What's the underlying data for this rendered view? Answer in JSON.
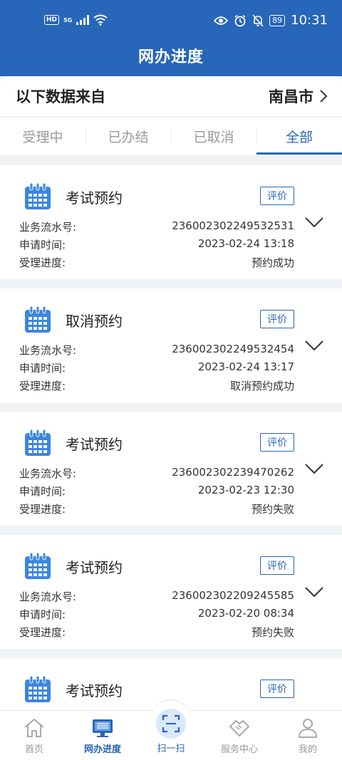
{
  "status_bar": {
    "hd": "HD",
    "network": "5G",
    "battery": "89",
    "time": "10:31"
  },
  "header": {
    "title": "网办进度"
  },
  "source": {
    "label": "以下数据来自",
    "city": "南昌市"
  },
  "tabs": [
    {
      "label": "受理中",
      "active": false
    },
    {
      "label": "已办结",
      "active": false
    },
    {
      "label": "已取消",
      "active": false
    },
    {
      "label": "全部",
      "active": true
    }
  ],
  "field_labels": {
    "serial": "业务流水号:",
    "time": "申请时间:",
    "progress": "受理进度:"
  },
  "rate_label": "评价",
  "records": [
    {
      "title": "考试预约",
      "serial": "236002302249532531",
      "time": "2023-02-24 13:18",
      "progress": "预约成功"
    },
    {
      "title": "取消预约",
      "serial": "236002302249532454",
      "time": "2023-02-24 13:17",
      "progress": "取消预约成功"
    },
    {
      "title": "考试预约",
      "serial": "236002302239470262",
      "time": "2023-02-23 12:30",
      "progress": "预约失败"
    },
    {
      "title": "考试预约",
      "serial": "236002302209245585",
      "time": "2023-02-20 08:34",
      "progress": "预约失败"
    },
    {
      "title": "考试预约",
      "serial": "",
      "time": "",
      "progress": ""
    }
  ],
  "bottom_nav": [
    {
      "label": "首页",
      "icon": "home-icon"
    },
    {
      "label": "网办进度",
      "icon": "monitor-icon"
    },
    {
      "label": "扫一扫",
      "icon": "scan-icon"
    },
    {
      "label": "服务中心",
      "icon": "handshake-icon"
    },
    {
      "label": "我的",
      "icon": "user-icon"
    }
  ],
  "colors": {
    "primary": "#2766b8",
    "icon_blue": "#3a86e0",
    "scan_bg": "#d9e8fa"
  }
}
